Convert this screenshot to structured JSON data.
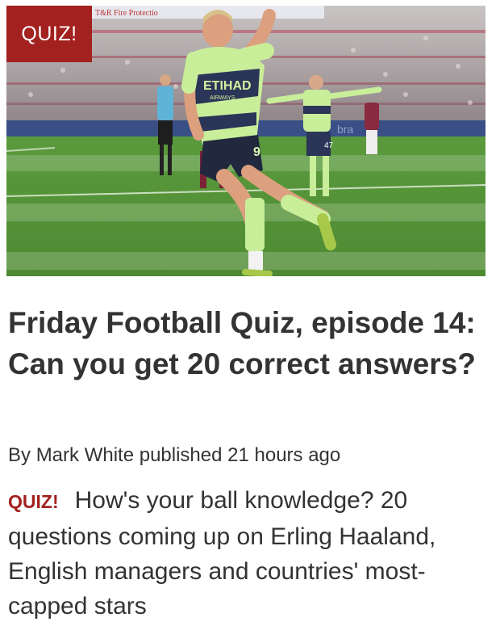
{
  "article": {
    "image": {
      "alt": "",
      "badge": "QUIZ!"
    },
    "headline": "Friday Football Quiz, episode 14: Can you get 20 correct answers?",
    "byline": {
      "prefix": "By",
      "author": "Mark White",
      "published": "published 21 hours ago"
    },
    "synopsis": {
      "tag": "QUIZ!",
      "text": "How's your ball knowledge? 20 questions coming up on Erling Haaland, English managers and countries' most-capped stars"
    },
    "photo_text": {
      "banner": "T&R Fire Protectio",
      "sponsor": "ETIHAD",
      "sponsor_sub": "AIRWAYS",
      "shirt_number": "9",
      "player2_number": "47",
      "board": "bra"
    }
  },
  "colors": {
    "accent": "#a3211f",
    "text": "#333333",
    "background": "#ffffff"
  }
}
